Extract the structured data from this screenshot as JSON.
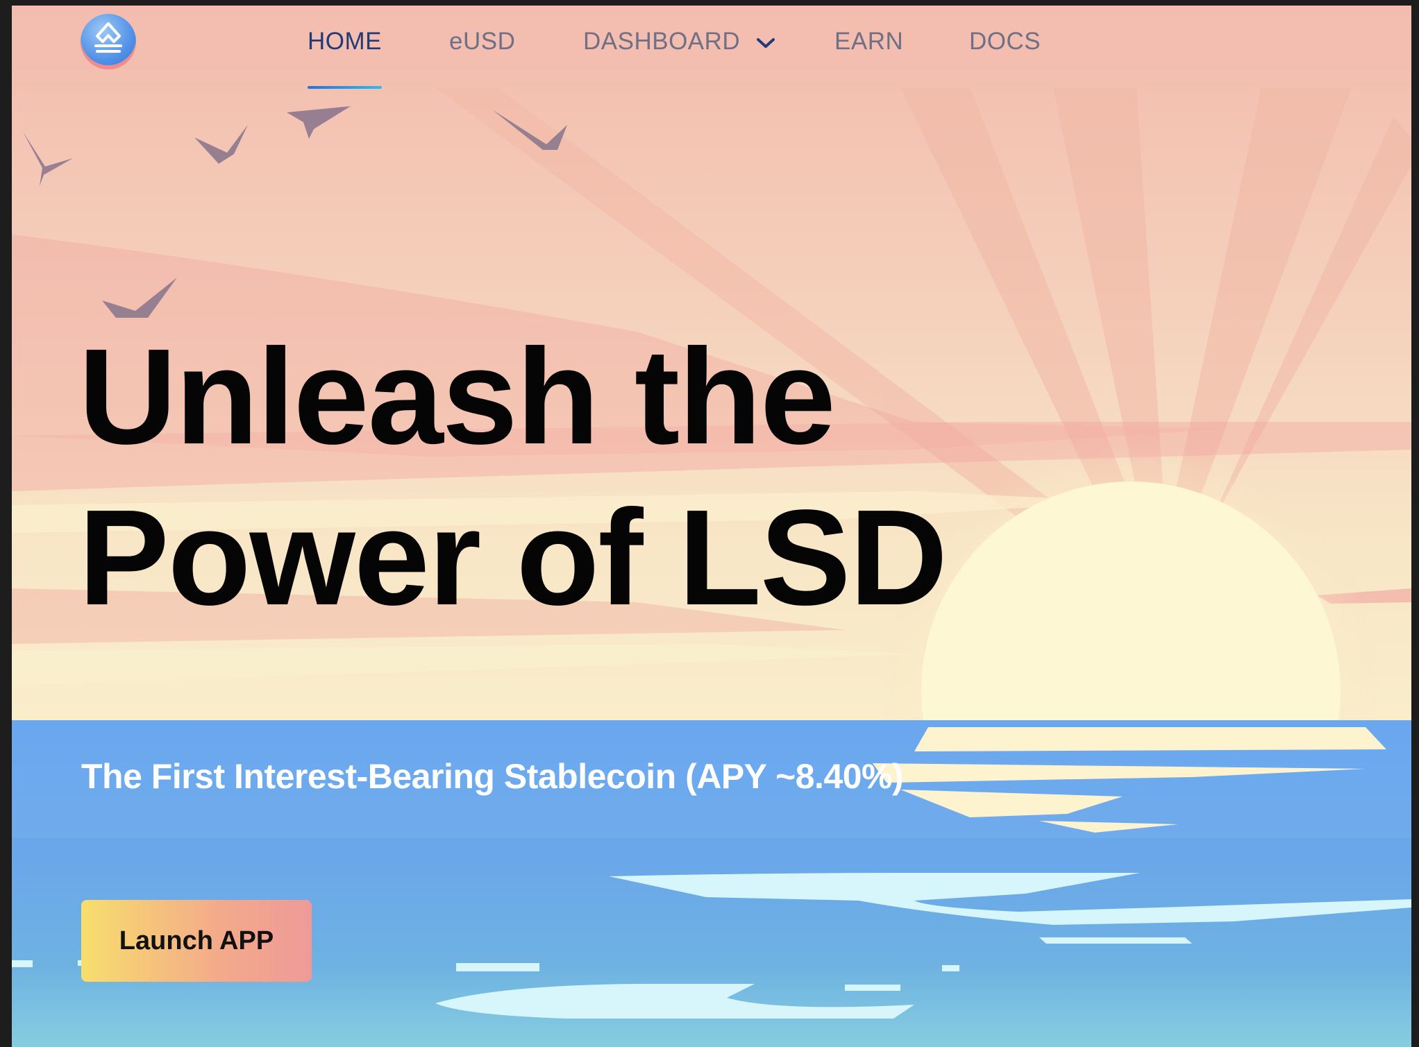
{
  "nav": {
    "items": [
      {
        "label": "HOME",
        "active": true
      },
      {
        "label": "eUSD",
        "active": false
      },
      {
        "label": "DASHBOARD",
        "active": false,
        "has_dropdown": true
      },
      {
        "label": "EARN",
        "active": false
      },
      {
        "label": "DOCS",
        "active": false
      }
    ],
    "logo_icon": "lsd-logo-icon",
    "dropdown_icon": "chevron-down-icon"
  },
  "hero": {
    "title_line1": "Unleash the",
    "title_line2": "Power of LSD",
    "subtitle": "The First Interest-Bearing Stablecoin (APY ~8.40%)",
    "cta_label": "Launch APP"
  },
  "colors": {
    "sky_top": "#f3bcae",
    "sun": "#fbf5cf",
    "sea": "#6ea9e8",
    "nav_active": "#233a78",
    "nav_inactive": "#6f6f86",
    "cta_gradient": [
      "#f7de6d",
      "#ef9a98"
    ]
  }
}
